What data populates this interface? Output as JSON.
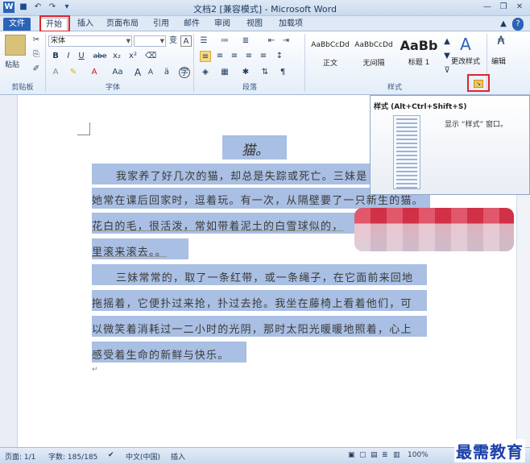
{
  "app": {
    "title": "文档2 [兼容模式] - Microsoft Word"
  },
  "tabs": [
    "文件",
    "开始",
    "插入",
    "页面布局",
    "引用",
    "邮件",
    "审阅",
    "视图",
    "加载项"
  ],
  "ribbon": {
    "clipboard": {
      "paste": "粘贴",
      "label": "剪贴板"
    },
    "font": {
      "name": "宋体",
      "size": "",
      "bold": "B",
      "italic": "I",
      "underline": "U",
      "strike": "abe",
      "subscript": "x₂",
      "superscript": "x²",
      "change_case": "Aa",
      "grow": "A",
      "shrink": "A",
      "label": "字体"
    },
    "paragraph": {
      "label": "段落"
    },
    "styles": {
      "label": "样式",
      "items": [
        {
          "sample": "AaBbCcDd",
          "name": "正文"
        },
        {
          "sample": "AaBbCcDd",
          "name": "无间隔"
        },
        {
          "sample": "AaBb",
          "name": "标题 1"
        }
      ],
      "change_styles": "更改样式"
    },
    "editing": {
      "label": "编辑"
    }
  },
  "tooltip": {
    "title": "样式 (Alt+Ctrl+Shift+S)",
    "description": "显示 “样式” 窗口。"
  },
  "document": {
    "title": "猫。",
    "lines": [
      "我家养了好几次的猫，却总是失踪或死亡。三妹是",
      "她常在课后回家时，逗着玩。有一次，从隔壁要了一只新生的猫。",
      "花白的毛，很活泼，常如带着泥土的白雪球似的，",
      "里滚来滚去。。",
      "三妹常常的，取了一条红带，或一条绳子，在它面前来回地",
      "拖摇着，它便扑过来抢，扑过去抢。我坐在藤椅上看着他们，可",
      "以微笑着消耗过一二小时的光阴，那时太阳光暖暖地照着，心上",
      "感受着生命的新鲜与快乐。"
    ]
  },
  "status": {
    "page": "页面: 1/1",
    "words": "字数: 185/185",
    "language": "中文(中国)",
    "mode": "插入",
    "zoom": "100%"
  },
  "watermark": "最需教育"
}
